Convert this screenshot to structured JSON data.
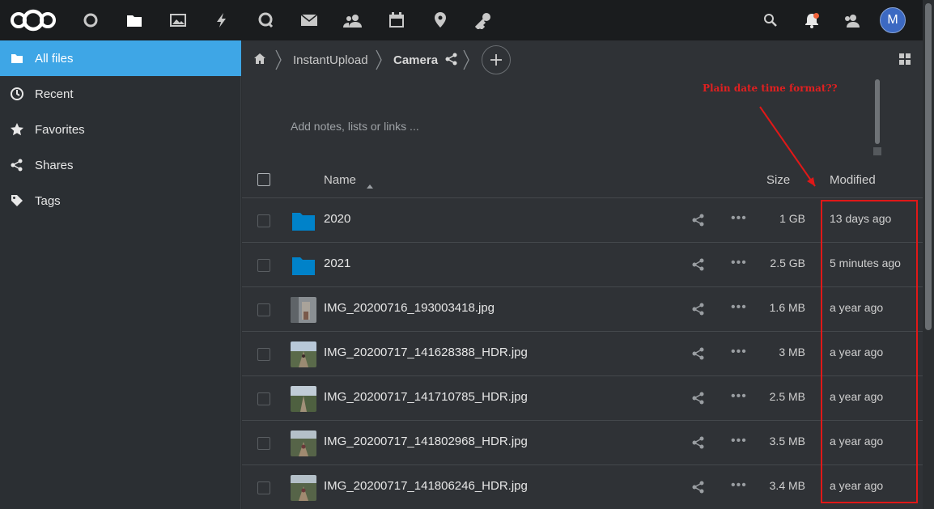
{
  "header": {
    "app_icons": [
      "dashboard-icon",
      "files-icon",
      "photos-icon",
      "activity-icon",
      "talk-icon",
      "mail-icon",
      "contacts-icon",
      "calendar-icon",
      "maps-icon",
      "passwords-icon"
    ],
    "avatar_initial": "M",
    "accent": "#3ea6e6"
  },
  "sidebar": {
    "items": [
      {
        "label": "All files",
        "icon": "folder-icon",
        "active": true
      },
      {
        "label": "Recent",
        "icon": "clock-icon",
        "active": false
      },
      {
        "label": "Favorites",
        "icon": "star-icon",
        "active": false
      },
      {
        "label": "Shares",
        "icon": "share-icon",
        "active": false
      },
      {
        "label": "Tags",
        "icon": "tag-icon",
        "active": false
      }
    ]
  },
  "breadcrumb": {
    "items": [
      "InstantUpload",
      "Camera"
    ]
  },
  "notes_placeholder": "Add notes, lists or links ...",
  "annotation": {
    "text": "Plain date time format??",
    "color": "#e01818"
  },
  "list": {
    "columns": {
      "name": "Name",
      "size": "Size",
      "modified": "Modified"
    },
    "rows": [
      {
        "name": "2020",
        "type": "folder",
        "size": "1 GB",
        "modified": "13 days ago"
      },
      {
        "name": "2021",
        "type": "folder",
        "size": "2.5 GB",
        "modified": "5 minutes ago"
      },
      {
        "name": "IMG_20200716_193003418.jpg",
        "type": "image",
        "size": "1.6 MB",
        "modified": "a year ago"
      },
      {
        "name": "IMG_20200717_141628388_HDR.jpg",
        "type": "image",
        "size": "3 MB",
        "modified": "a year ago"
      },
      {
        "name": "IMG_20200717_141710785_HDR.jpg",
        "type": "image",
        "size": "2.5 MB",
        "modified": "a year ago"
      },
      {
        "name": "IMG_20200717_141802968_HDR.jpg",
        "type": "image",
        "size": "3.5 MB",
        "modified": "a year ago"
      },
      {
        "name": "IMG_20200717_141806246_HDR.jpg",
        "type": "image",
        "size": "3.4 MB",
        "modified": "a year ago"
      }
    ]
  }
}
